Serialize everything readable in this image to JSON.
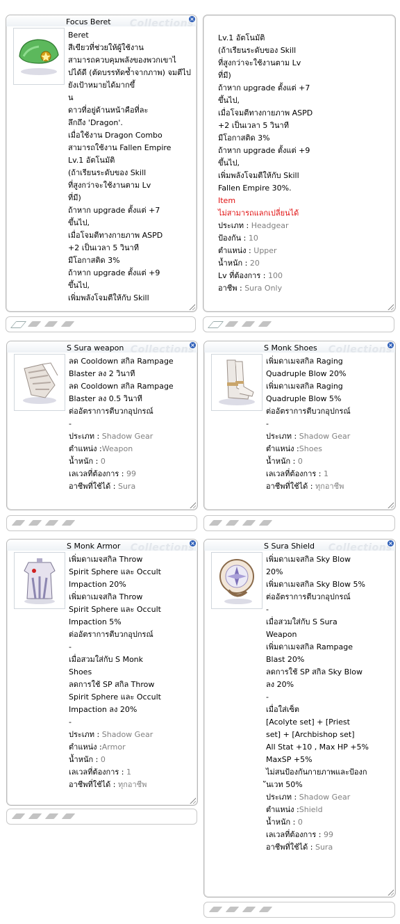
{
  "watermark": "Collections",
  "close_glyph": "×",
  "windows": [
    {
      "title": "Focus Beret",
      "icon": "green-beret-icon",
      "lines": [
        {
          "t": "Beret"
        },
        {
          "t": "สีเขียวที่ช่วยให้ผู้ใช้งาน"
        },
        {
          "t": "สามารถควบคุมพลังของพวกเขาไ"
        },
        {
          "t": "ปได้ดี (ตัดบรรทัดซ้ำจากภาพ) จมตีไปยังเป้าหมายได้มากขึ้"
        },
        {
          "t": "น"
        },
        {
          "t": "ดาวที่อยู่ด้านหน้าคือที่ละ"
        },
        {
          "t": "ลึกถึง 'Dragon'."
        },
        {
          "t": "เมื่อใช้งาน Dragon Combo"
        },
        {
          "t": "สามารถใช้งาน Fallen Empire"
        },
        {
          "t": "Lv.1 อัตโนมัติ"
        },
        {
          "t": "(ถ้าเรียนระดับของ Skill"
        },
        {
          "t": "ที่สูงกว่าจะใช้งานตาม Lv"
        },
        {
          "t": "ที่มี)"
        },
        {
          "t": "ถ้าหาก upgrade ตั้งแต่ +7"
        },
        {
          "t": "ขึ้นไป,"
        },
        {
          "t": "เมื่อโจมตีทางกายภาพ ASPD"
        },
        {
          "t": "+2 เป็นเวลา 5 วินาที"
        },
        {
          "t": "มีโอกาสติด 3%"
        },
        {
          "t": "ถ้าหาก upgrade ตั้งแต่ +9"
        },
        {
          "t": "ขึ้นไป,"
        },
        {
          "t": "เพิ่มพลังโจมตีให้กับ Skill"
        }
      ],
      "slots": [
        true,
        false,
        false,
        false
      ]
    },
    {
      "title": "",
      "icon": "",
      "lines": [
        {
          "t": "Lv.1 อัตโนมัติ"
        },
        {
          "t": "(ถ้าเรียนระดับของ Skill"
        },
        {
          "t": "ที่สูงกว่าจะใช้งานตาม Lv"
        },
        {
          "t": "ที่มี)"
        },
        {
          "t": "ถ้าหาก upgrade ตั้งแต่ +7"
        },
        {
          "t": "ขึ้นไป,"
        },
        {
          "t": "เมื่อโจมตีทางกายภาพ ASPD"
        },
        {
          "t": "+2 เป็นเวลา 5 วินาที"
        },
        {
          "t": "มีโอกาสติด 3%"
        },
        {
          "t": "ถ้าหาก upgrade ตั้งแต่ +9"
        },
        {
          "t": "ขึ้นไป,"
        },
        {
          "t": "เพิ่มพลังโจมตีให้กับ Skill"
        },
        {
          "t": "Fallen Empire 30%."
        },
        {
          "t": "Item",
          "c": "red"
        },
        {
          "t": "ไม่สามารถแลกเปลี่ยนได้",
          "c": "red"
        },
        {
          "t": "ประเภท : ",
          "v": "Headgear"
        },
        {
          "t": "ป้องกัน : ",
          "v": "10"
        },
        {
          "t": "ตำแหน่ง : ",
          "v": "Upper"
        },
        {
          "t": "น้ำหนัก : ",
          "v": "20"
        },
        {
          "t": "Lv ที่ต้องการ : ",
          "v": "100"
        },
        {
          "t": "อาชีพ : ",
          "v": "Sura Only"
        }
      ],
      "slots": [
        true,
        false,
        false,
        false
      ]
    },
    {
      "title": "S Sura weapon",
      "icon": "gauntlet-icon",
      "lines": [
        {
          "t": "ลด Cooldown สกิล Rampage"
        },
        {
          "t": "Blaster ลง 2 วินาที"
        },
        {
          "t": "ลด Cooldown สกิล Rampage"
        },
        {
          "t": "Blaster ลง 0.5 วินาที"
        },
        {
          "t": "ต่ออัตราการตีบวกอุปกรณ์"
        },
        {
          "t": "-"
        },
        {
          "t": "ประเภท : ",
          "v": "Shadow Gear"
        },
        {
          "t": "ตำแหน่ง :",
          "v": "Weapon"
        },
        {
          "t": "น้ำหนัก : ",
          "v": "0"
        },
        {
          "t": "เลเวลที่ต้องการ : ",
          "v": "99"
        },
        {
          "t": "อาชีพที่ใช้ได้ : ",
          "v": "Sura"
        }
      ],
      "slots": [
        false,
        false,
        false,
        false
      ]
    },
    {
      "title": "S Monk Shoes",
      "icon": "boots-icon",
      "lines": [
        {
          "t": "เพิ่มดาเมจสกิล Raging"
        },
        {
          "t": "Quadruple Blow 20%"
        },
        {
          "t": "เพิ่มดาเมจสกิล Raging"
        },
        {
          "t": "Quadruple Blow 5%"
        },
        {
          "t": " ต่ออัตราการตีบวกอุปกรณ์"
        },
        {
          "t": "-"
        },
        {
          "t": "ประเภท : ",
          "v": "Shadow Gear"
        },
        {
          "t": "ตำแหน่ง :",
          "v": "Shoes"
        },
        {
          "t": "น้ำหนัก : ",
          "v": "0"
        },
        {
          "t": "เลเวลที่ต้องการ : ",
          "v": "1"
        },
        {
          "t": "อาชีพที่ใช้ได้ : ",
          "v": "ทุกอาชีพ"
        }
      ],
      "slots": [
        false,
        false,
        false,
        false
      ]
    },
    {
      "title": "S Monk Armor",
      "icon": "armor-icon",
      "lines": [
        {
          "t": "เพิ่มดาเมจสกิล Throw"
        },
        {
          "t": "Spirit Sphere และ Occult"
        },
        {
          "t": "Impaction 20%"
        },
        {
          "t": "เพิ่มดาเมจสกิล Throw"
        },
        {
          "t": "Spirit Sphere และ Occult"
        },
        {
          "t": "Impaction 5%"
        },
        {
          "t": " ต่ออัตราการตีบวกอุปกรณ์"
        },
        {
          "t": "-"
        },
        {
          "t": "เมื่อสวมใส่กับ S Monk"
        },
        {
          "t": "Shoes"
        },
        {
          "t": "ลดการใช้ SP สกิล Throw"
        },
        {
          "t": "Spirit Sphere และ Occult"
        },
        {
          "t": "Impaction ลง 20%"
        },
        {
          "t": "-"
        },
        {
          "t": "ประเภท : ",
          "v": "Shadow Gear"
        },
        {
          "t": "ตำแหน่ง :",
          "v": "Armor"
        },
        {
          "t": "น้ำหนัก : ",
          "v": "0"
        },
        {
          "t": "เลเวลที่ต้องการ : ",
          "v": "1"
        },
        {
          "t": "อาชีพที่ใช้ได้ : ",
          "v": "ทุกอาชีพ"
        }
      ],
      "slots": [
        false,
        false,
        false,
        false
      ]
    },
    {
      "title": "S Sura Shield",
      "icon": "shield-icon",
      "lines": [
        {
          "t": "เพิ่มดาเมจสกิล Sky Blow"
        },
        {
          "t": "20%"
        },
        {
          "t": "เพิ่มดาเมจสกิล Sky Blow 5%"
        },
        {
          "t": " ต่ออัตราการตีบวกอุปกรณ์"
        },
        {
          "t": "-"
        },
        {
          "t": "เมื่อสวมใส่กับ S Sura"
        },
        {
          "t": "Weapon"
        },
        {
          "t": "เพิ่มดาเมจสกิล Rampage"
        },
        {
          "t": "Blast 20%"
        },
        {
          "t": "ลดการใช้ SP สกิล Sky Blow"
        },
        {
          "t": "ลง 20%"
        },
        {
          "t": "-"
        },
        {
          "t": "เมื่อใส่เซ็ต"
        },
        {
          "t": "[Acolyte set] + [Priest"
        },
        {
          "t": "set] + [Archbishop set]"
        },
        {
          "t": "All Stat +10 , Max HP +5%"
        },
        {
          "t": "MaxSP +5%"
        },
        {
          "t": "ไม่สนป้องกันกายภาพและป้องก"
        },
        {
          "t": "ันเวท 50%"
        },
        {
          "t": " ประเภท : ",
          "v": "Shadow Gear"
        },
        {
          "t": " ตำแหน่ง :",
          "v": "Shield"
        },
        {
          "t": " น้ำหนัก : ",
          "v": "0"
        },
        {
          "t": " เลเวลที่ต้องการ : ",
          "v": "99"
        },
        {
          "t": " อาชีพที่ใช้ได้ : ",
          "v": "Sura"
        }
      ],
      "slots": [
        false,
        false,
        false,
        false
      ]
    }
  ]
}
